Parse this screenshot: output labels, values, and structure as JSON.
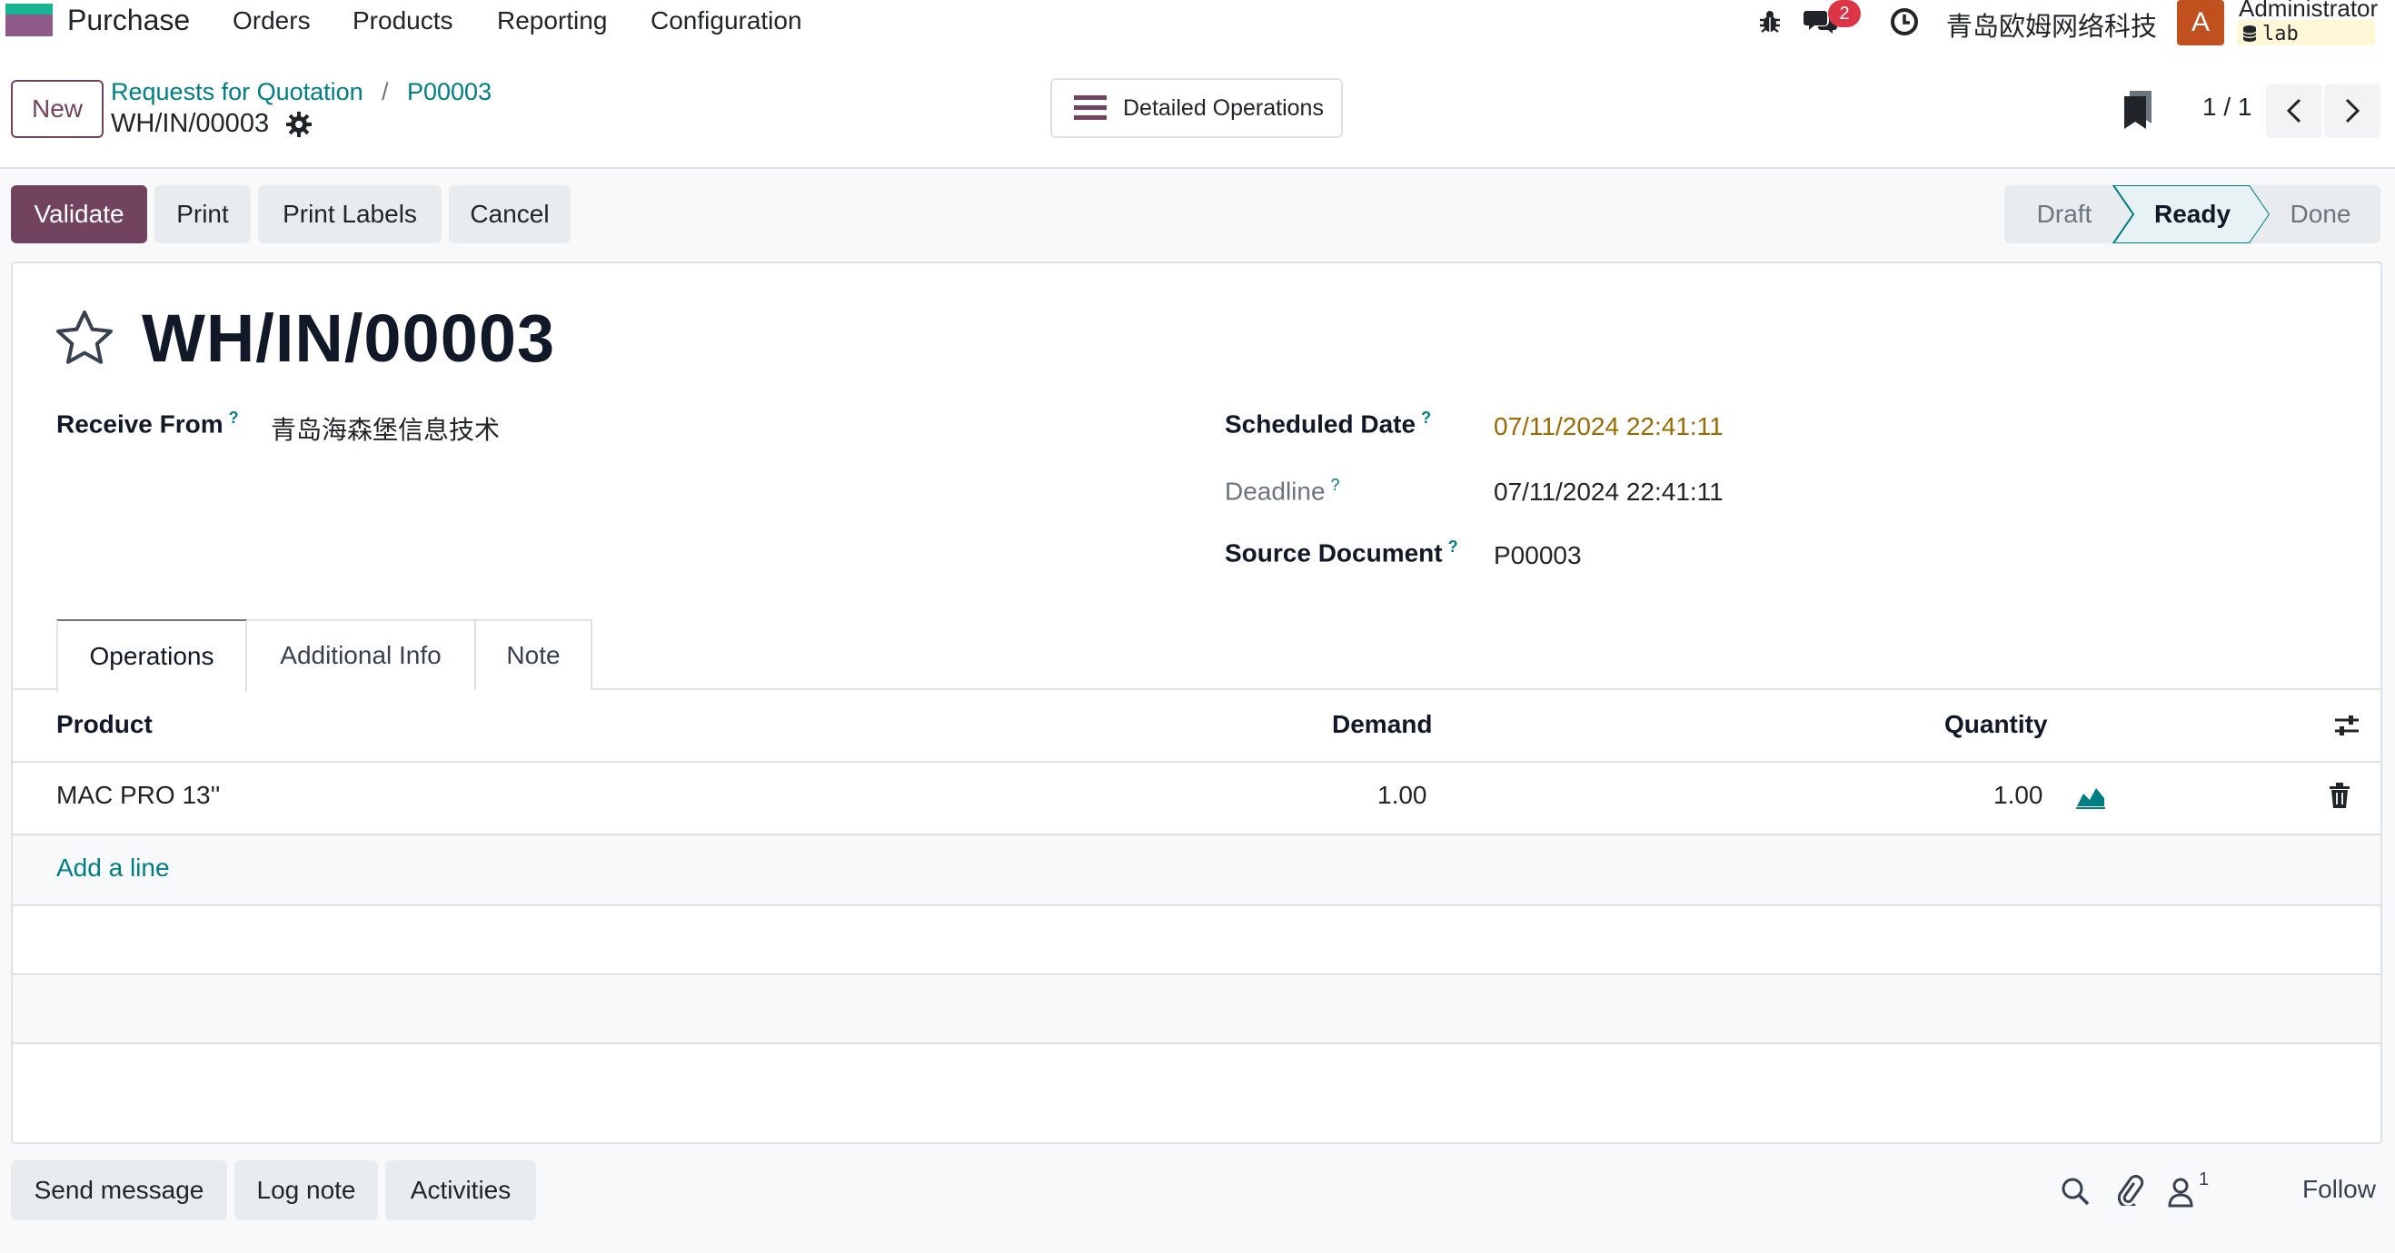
{
  "navbar": {
    "app_name": "Purchase",
    "menu": [
      "Orders",
      "Products",
      "Reporting",
      "Configuration"
    ],
    "messages_count": "2",
    "company": "青岛欧姆网络科技",
    "avatar_letter": "A",
    "user_name": "Administrator",
    "database": "lab"
  },
  "control_panel": {
    "new_label": "New",
    "breadcrumbs": [
      "Requests for Quotation",
      "P00003"
    ],
    "record_name": "WH/IN/00003",
    "detailed_operations_label": "Detailed Operations",
    "pager": "1 / 1"
  },
  "actions": {
    "validate": "Validate",
    "print": "Print",
    "print_labels": "Print Labels",
    "cancel": "Cancel"
  },
  "status": {
    "stages": [
      "Draft",
      "Ready",
      "Done"
    ],
    "current": "Ready"
  },
  "form": {
    "title": "WH/IN/00003",
    "receive_from_label": "Receive From",
    "receive_from": "青岛海森堡信息技术",
    "scheduled_date_label": "Scheduled Date",
    "scheduled_date": "07/11/2024 22:41:11",
    "deadline_label": "Deadline",
    "deadline": "07/11/2024 22:41:11",
    "source_document_label": "Source Document",
    "source_document": "P00003",
    "help_marker": "?"
  },
  "tabs": {
    "items": [
      "Operations",
      "Additional Info",
      "Note"
    ],
    "active": "Operations"
  },
  "operations_table": {
    "columns": [
      "Product",
      "Demand",
      "Quantity"
    ],
    "rows": [
      {
        "product": "MAC PRO 13''",
        "demand": "1.00",
        "quantity": "1.00"
      }
    ],
    "add_line": "Add a line"
  },
  "chatter": {
    "send_message": "Send message",
    "log_note": "Log note",
    "activities": "Activities",
    "followers_count": "1",
    "follow": "Follow"
  },
  "colors": {
    "primary": "#71435e",
    "link": "#017e84",
    "warning_date": "#9a6a00",
    "badge": "#dc3545"
  }
}
